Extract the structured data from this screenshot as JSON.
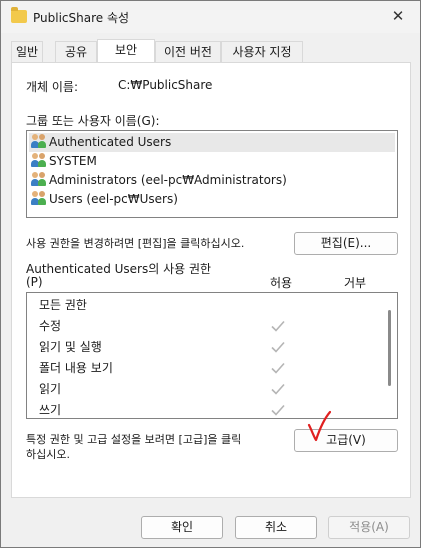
{
  "window": {
    "title": "PublicShare 속성",
    "close_glyph": "✕"
  },
  "tabs": [
    {
      "label": "일반"
    },
    {
      "label": "공유"
    },
    {
      "label": "보안"
    },
    {
      "label": "이전 버전"
    },
    {
      "label": "사용자 지정"
    }
  ],
  "security": {
    "object_name_label": "개체 이름:",
    "object_name_value": "C:₩PublicShare",
    "groups_label": "그룹 또는 사용자 이름(G):",
    "users": [
      {
        "name": "Authenticated Users",
        "icon": "users-icon"
      },
      {
        "name": "SYSTEM",
        "icon": "users-icon"
      },
      {
        "name": "Administrators (eel-pc₩Administrators)",
        "icon": "users-icon"
      },
      {
        "name": "Users (eel-pc₩Users)",
        "icon": "users-icon"
      }
    ],
    "edit_hint": "사용 권한을 변경하려면 [편집]을 클릭하십시오.",
    "edit_button": "편집(E)...",
    "permissions_label_line1": "Authenticated Users의 사용 권한",
    "permissions_label_line2": "(P)",
    "allow_header": "허용",
    "deny_header": "거부",
    "permissions": [
      {
        "name": "모든 권한",
        "allow": false
      },
      {
        "name": "수정",
        "allow": true
      },
      {
        "name": "읽기 및 실행",
        "allow": true
      },
      {
        "name": "폴더 내용 보기",
        "allow": true
      },
      {
        "name": "읽기",
        "allow": true
      },
      {
        "name": "쓰기",
        "allow": true
      }
    ],
    "advanced_hint_line1": "특정 권한 및 고급 설정을 보려면 [고급]을 클릭",
    "advanced_hint_line2": "하십시오.",
    "advanced_button": "고급(V)"
  },
  "footer": {
    "ok_button": "확인",
    "cancel_button": "취소",
    "apply_button": "적용(A)"
  },
  "colors": {
    "check_gray": "#b5b5b5",
    "annotation_red": "#e02020"
  }
}
